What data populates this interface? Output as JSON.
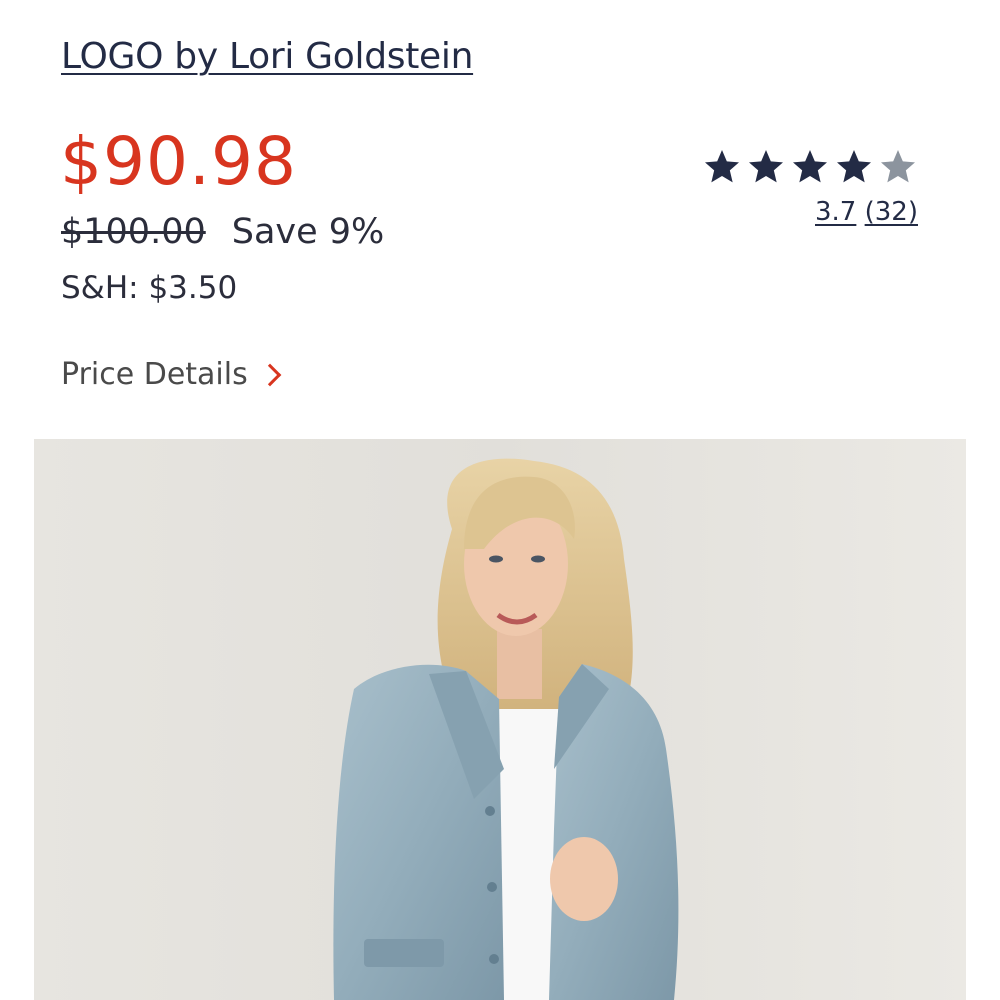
{
  "product": {
    "brand": "LOGO by Lori Goldstein",
    "price": "$90.98",
    "original_price": "$100.00",
    "savings": "Save 9%",
    "shipping": "S&H: $3.50",
    "price_details_label": "Price Details",
    "image_alt": "Denim jacket"
  },
  "rating": {
    "value": 3.7,
    "value_label": "3.7",
    "count_label": "(32)",
    "max": 5
  },
  "colors": {
    "price": "#d8351f",
    "brand": "#232b45",
    "star_filled": "#232b45",
    "star_empty": "#8c949e"
  }
}
